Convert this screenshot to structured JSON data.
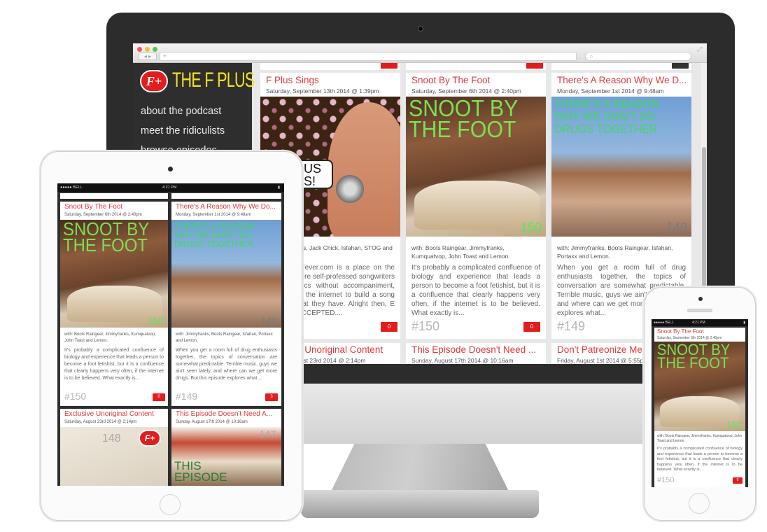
{
  "site": {
    "logo_mark": "F+",
    "logo_text": "THE F PLUS"
  },
  "nav": [
    "about the podcast",
    "meet the ridiculists",
    "browse episodes"
  ],
  "browser": {
    "url_glyph": "+",
    "nav_arrows": "◂ ▸"
  },
  "desktop": {
    "row0": [
      {
        "title": "F Plus Sings",
        "date": "Saturday, September 13th 2014 @ 1:39pm",
        "with": "with: Boots Raingear, Jimmyfranks, Jack Chick, Isfahan, STOG and Lemon.",
        "with_visible": "nks, Jack Chick, Isfahan, STOG and",
        "desc_visible": "gFever.com is a place on the here self-professed songwriters yrics without accompaniment, to the internet to build a song that they have. Alright then, E ACCEPTED....",
        "bubble": "US S!",
        "badge": "0"
      },
      {
        "title": "Snoot By The Foot",
        "date": "Saturday, September 6th 2014 @ 2:40pm",
        "image_title": "SNOOT BY THE FOOT",
        "image_num": "150",
        "with": "with: Boots Raingear, Jimmyfranks, Kumquatvop, John Toast and Lemon.",
        "desc": "It's probably a complicated confluence of biology and experience that leads a person to become a foot fetishist, but it is a confluence that clearly happens very often, if the internet is to be believed. What exactly is...",
        "ep": "#150",
        "badge": "0"
      },
      {
        "title": "There's A Reason Why We D...",
        "date": "Monday, September 1st 2014 @ 9:48am",
        "image_title": "THERE'S A REASON WHY WE DON'T DO DRUGS TOGETHER.",
        "image_num": "149",
        "with": "with: Jimmyfranks, Boots Raingear, Isfahan, Portaxx and Lemon.",
        "desc": "When you get a room full of drug enthusiasts together, the topics of conversation are somewhat predictable. Terrible music, guys we ain't seen lately, and where can we get more d... episode explores what...",
        "ep": "#149"
      }
    ],
    "row1": [
      {
        "title": "e Unoriginal Content",
        "date": "gust 23rd 2014 @ 2:14pm"
      },
      {
        "title": "This Episode Doesn't Need ...",
        "date": "Sunday, August 17th 2014 @ 10:16am"
      },
      {
        "title": "Don't Patreonize Me",
        "date": "Friday, August 1st 2014 @ 5:55pm"
      }
    ]
  },
  "tablet": {
    "status": {
      "carrier": "●●●●● BELL",
      "time": "4:21 PM"
    },
    "cards": [
      {
        "title": "Snoot By The Foot",
        "date": "Saturday, September 6th 2014 @ 2:40pm",
        "image_title": "SNOOT BY THE FOOT",
        "image_num": "150",
        "with": "with: Boots Raingear, Jimmyfranks, Kumquatvop, John Toast and Lemon.",
        "desc": "It's probably a complicated confluence of biology and experience that leads a person to become a foot fetishist, but it is a confluence that clearly happens very often, if the internet is to be believed. What exactly is...",
        "ep": "#150",
        "badge": "0"
      },
      {
        "title": "There's A Reason Why We Do...",
        "date": "Monday, September 1st 2014 @ 9:48am",
        "image_title": "THERE'S A REASON WHY WE DON'T DO DRUGS TOGETHER.",
        "image_num": "149",
        "with": "with: Jimmyfranks, Boots Raingear, Isfahan, Portaxx and Lemon.",
        "desc": "When you get a room full of drug enthusiasts together, the topics of conversation are somewhat predictable. Terrible music, guys we ain't seen lately, and where can we get more drugs. But this episode explores what...",
        "ep": "#149",
        "badge": "3"
      },
      {
        "title": "Exclusive Unoriginal Content",
        "date": "Saturday, August 23rd 2014 @ 2:14pm",
        "image_num": "148"
      },
      {
        "title": "This Episode Doesn't Need A...",
        "date": "Sunday, August 17th 2014 @ 10:16am",
        "image_title": "THIS EPISODE",
        "image_num": "147"
      }
    ]
  },
  "phone": {
    "status": {
      "carrier": "●●●●● BELL",
      "time": "4:21 PM"
    },
    "card": {
      "title": "Snoot By The Foot",
      "date": "Saturday, September 6th 2014 @ 2:40pm",
      "image_title": "SNOOT BY THE FOOT",
      "image_num": "150",
      "with": "with: Boots Raingear, Jimmyfranks, Kumquatvop, John Toast and Lemon.",
      "desc": "It's probably a complicated confluence of biology and experience that leads a person to become a foot fetishist, but it is a confluence that clearly happens very often, if the internet is to be believed. What exactly is...",
      "ep": "#150",
      "badge": "0"
    }
  }
}
